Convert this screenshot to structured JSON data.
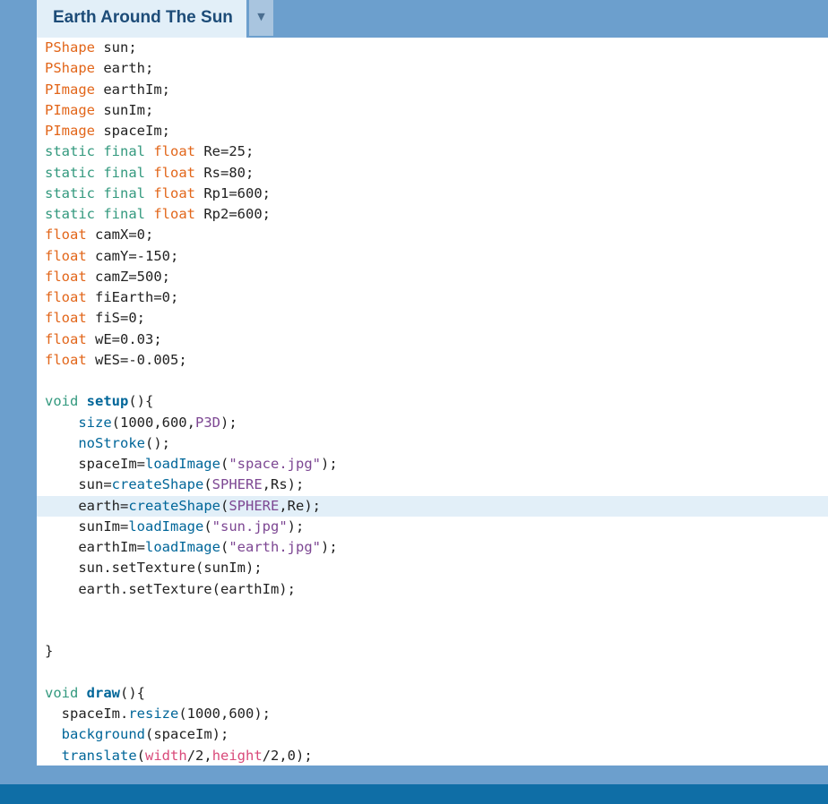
{
  "tab": {
    "title": "Earth Around The Sun",
    "menu_icon": "▼"
  },
  "current_line": 23,
  "lines": [
    {
      "n": "1",
      "t": [
        [
          "PShape",
          "type"
        ],
        [
          " sun;",
          ""
        ]
      ]
    },
    {
      "n": "2",
      "t": [
        [
          "PShape",
          "type"
        ],
        [
          " earth;",
          ""
        ]
      ]
    },
    {
      "n": "3",
      "t": [
        [
          "PImage",
          "type"
        ],
        [
          " earthIm;",
          ""
        ]
      ]
    },
    {
      "n": "4",
      "t": [
        [
          "PImage",
          "type"
        ],
        [
          " sunIm;",
          ""
        ]
      ]
    },
    {
      "n": "5",
      "t": [
        [
          "PImage",
          "type"
        ],
        [
          " spaceIm;",
          ""
        ]
      ]
    },
    {
      "n": "6",
      "t": [
        [
          "static final",
          "kw"
        ],
        [
          " ",
          ""
        ],
        [
          "float",
          "type"
        ],
        [
          " Re=25;",
          ""
        ]
      ]
    },
    {
      "n": "7",
      "t": [
        [
          "static final",
          "kw"
        ],
        [
          " ",
          ""
        ],
        [
          "float",
          "type"
        ],
        [
          " Rs=80;",
          ""
        ]
      ]
    },
    {
      "n": "8",
      "t": [
        [
          "static final",
          "kw"
        ],
        [
          " ",
          ""
        ],
        [
          "float",
          "type"
        ],
        [
          " Rp1=600;",
          ""
        ]
      ]
    },
    {
      "n": "9",
      "t": [
        [
          "static final",
          "kw"
        ],
        [
          " ",
          ""
        ],
        [
          "float",
          "type"
        ],
        [
          " Rp2=600;",
          ""
        ]
      ]
    },
    {
      "n": "10",
      "t": [
        [
          "float",
          "type"
        ],
        [
          " camX=0;",
          ""
        ]
      ]
    },
    {
      "n": "11",
      "t": [
        [
          "float",
          "type"
        ],
        [
          " camY=-150;",
          ""
        ]
      ]
    },
    {
      "n": "12",
      "t": [
        [
          "float",
          "type"
        ],
        [
          " camZ=500;",
          ""
        ]
      ]
    },
    {
      "n": "13",
      "t": [
        [
          "float",
          "type"
        ],
        [
          " fiEarth=0;",
          ""
        ]
      ]
    },
    {
      "n": "14",
      "t": [
        [
          "float",
          "type"
        ],
        [
          " fiS=0;",
          ""
        ]
      ]
    },
    {
      "n": "15",
      "t": [
        [
          "float",
          "type"
        ],
        [
          " wE=0.03;",
          ""
        ]
      ]
    },
    {
      "n": "16",
      "t": [
        [
          "float",
          "type"
        ],
        [
          " wES=-0.005;",
          ""
        ]
      ]
    },
    {
      "n": "17",
      "t": []
    },
    {
      "n": "18",
      "t": [
        [
          "void",
          "kw"
        ],
        [
          " ",
          ""
        ],
        [
          "setup",
          "fnb"
        ],
        [
          "(){",
          ""
        ]
      ]
    },
    {
      "n": "19",
      "t": [
        [
          "    ",
          ""
        ],
        [
          "size",
          "fn"
        ],
        [
          "(1000,600,",
          ""
        ],
        [
          "P3D",
          "const2"
        ],
        [
          ");",
          ""
        ]
      ]
    },
    {
      "n": "20",
      "t": [
        [
          "    ",
          ""
        ],
        [
          "noStroke",
          "fn"
        ],
        [
          "();",
          ""
        ]
      ]
    },
    {
      "n": "21",
      "t": [
        [
          "    spaceIm=",
          ""
        ],
        [
          "loadImage",
          "fn"
        ],
        [
          "(",
          ""
        ],
        [
          "\"space.jpg\"",
          "str"
        ],
        [
          ");",
          ""
        ]
      ]
    },
    {
      "n": "22",
      "t": [
        [
          "    sun=",
          ""
        ],
        [
          "createShape",
          "fn"
        ],
        [
          "(",
          ""
        ],
        [
          "SPHERE",
          "const2"
        ],
        [
          ",Rs);",
          ""
        ]
      ]
    },
    {
      "n": "23",
      "t": [
        [
          "    earth=",
          ""
        ],
        [
          "createShape",
          "fn"
        ],
        [
          "(",
          ""
        ],
        [
          "SPHERE",
          "const2"
        ],
        [
          ",Re);",
          ""
        ]
      ]
    },
    {
      "n": "24",
      "t": [
        [
          "    sunIm=",
          ""
        ],
        [
          "loadImage",
          "fn"
        ],
        [
          "(",
          ""
        ],
        [
          "\"sun.jpg\"",
          "str"
        ],
        [
          ");",
          ""
        ]
      ]
    },
    {
      "n": "25",
      "t": [
        [
          "    earthIm=",
          ""
        ],
        [
          "loadImage",
          "fn"
        ],
        [
          "(",
          ""
        ],
        [
          "\"earth.jpg\"",
          "str"
        ],
        [
          ");",
          ""
        ]
      ]
    },
    {
      "n": "26",
      "t": [
        [
          "    sun.setTexture(sunIm);",
          ""
        ]
      ]
    },
    {
      "n": "27",
      "t": [
        [
          "    earth.setTexture(earthIm);",
          ""
        ]
      ]
    },
    {
      "n": "28",
      "t": []
    },
    {
      "n": "29",
      "t": []
    },
    {
      "n": "30",
      "t": [
        [
          "}",
          ""
        ]
      ]
    },
    {
      "n": "31",
      "t": []
    },
    {
      "n": "32",
      "t": [
        [
          "void",
          "kw"
        ],
        [
          " ",
          ""
        ],
        [
          "draw",
          "fnb"
        ],
        [
          "(){",
          ""
        ]
      ]
    },
    {
      "n": "33",
      "t": [
        [
          "  spaceIm.",
          ""
        ],
        [
          "resize",
          "fn"
        ],
        [
          "(1000,600);",
          ""
        ]
      ]
    },
    {
      "n": "34",
      "t": [
        [
          "  ",
          ""
        ],
        [
          "background",
          "fn"
        ],
        [
          "(spaceIm);",
          ""
        ]
      ]
    },
    {
      "n": "35",
      "t": [
        [
          "  ",
          ""
        ],
        [
          "translate",
          "fn"
        ],
        [
          "(",
          ""
        ],
        [
          "width",
          "var"
        ],
        [
          "/2,",
          ""
        ],
        [
          "height",
          "var"
        ],
        [
          "/2,0);",
          ""
        ]
      ]
    }
  ],
  "colors": {
    "frame": "#6c9fcd",
    "tab_bg": "#e2eff8",
    "type": "#e2661a",
    "keyword": "#33997e",
    "function": "#006699",
    "string": "#7d4793",
    "builtin_var": "#d94a7a"
  }
}
